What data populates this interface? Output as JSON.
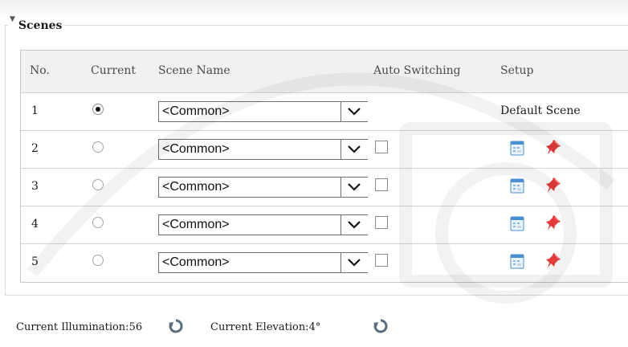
{
  "group": {
    "title": "Scenes"
  },
  "table": {
    "headers": {
      "no": "No.",
      "current": "Current",
      "scene_name": "Scene Name",
      "auto_switching": "Auto Switching",
      "setup": "Setup"
    },
    "rows": [
      {
        "no": "1",
        "current": true,
        "scene": "<Common>",
        "auto_switching_visible": false,
        "setup_text": "Default Scene"
      },
      {
        "no": "2",
        "current": false,
        "scene": "<Common>",
        "auto_switching_visible": true,
        "auto_switching": false
      },
      {
        "no": "3",
        "current": false,
        "scene": "<Common>",
        "auto_switching_visible": true,
        "auto_switching": false
      },
      {
        "no": "4",
        "current": false,
        "scene": "<Common>",
        "auto_switching_visible": true,
        "auto_switching": false
      },
      {
        "no": "5",
        "current": false,
        "scene": "<Common>",
        "auto_switching_visible": true,
        "auto_switching": false
      }
    ]
  },
  "status": {
    "illumination_label": "Current Illumination:56",
    "elevation_label": "Current Elevation:4°"
  },
  "icons": {
    "collapse": "triangle-down-icon",
    "dropdown": "chevron-down-icon",
    "edit": "calendar-edit-icon",
    "pin": "red-pin-icon",
    "refresh": "refresh-icon"
  },
  "colors": {
    "pin": "#e23b3b",
    "calendar": "#4a8fd0",
    "refresh": "#5a6e7f",
    "header_bg": "#f1f1f1"
  }
}
